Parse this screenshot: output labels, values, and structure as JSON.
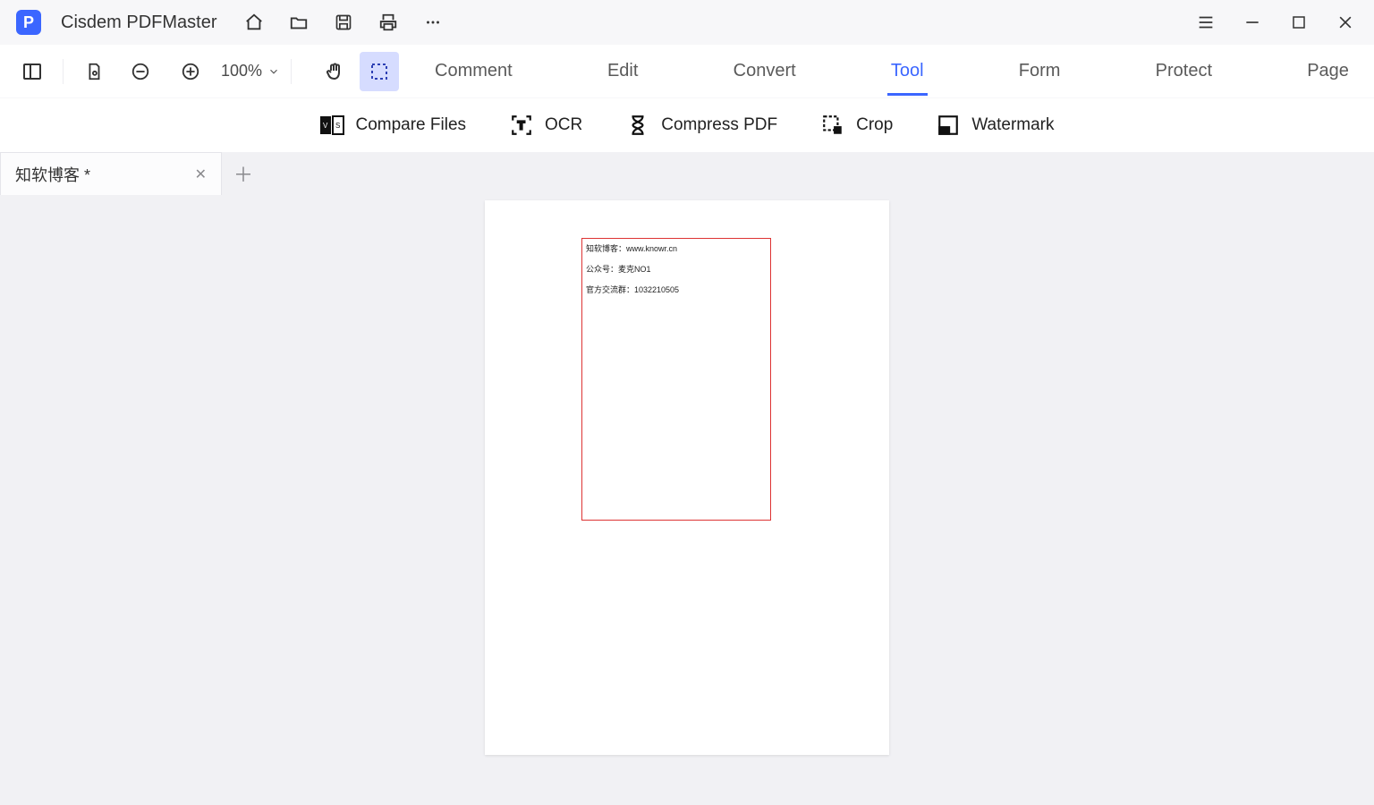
{
  "app": {
    "title": "Cisdem PDFMaster",
    "logo_letter": "P"
  },
  "toolbar": {
    "zoom_label": "100%"
  },
  "main_tabs": {
    "comment": "Comment",
    "edit": "Edit",
    "convert": "Convert",
    "tool": "Tool",
    "form": "Form",
    "protect": "Protect",
    "page": "Page"
  },
  "tool_sub": {
    "compare": "Compare Files",
    "ocr": "OCR",
    "compress": "Compress PDF",
    "crop": "Crop",
    "watermark": "Watermark"
  },
  "doc_tabs": {
    "active_name": "知软博客 *"
  },
  "page_content": {
    "line1": "知软博客：www.knowr.cn",
    "line2": "公众号：麦克NO1",
    "line3": "官方交流群：1032210505"
  }
}
